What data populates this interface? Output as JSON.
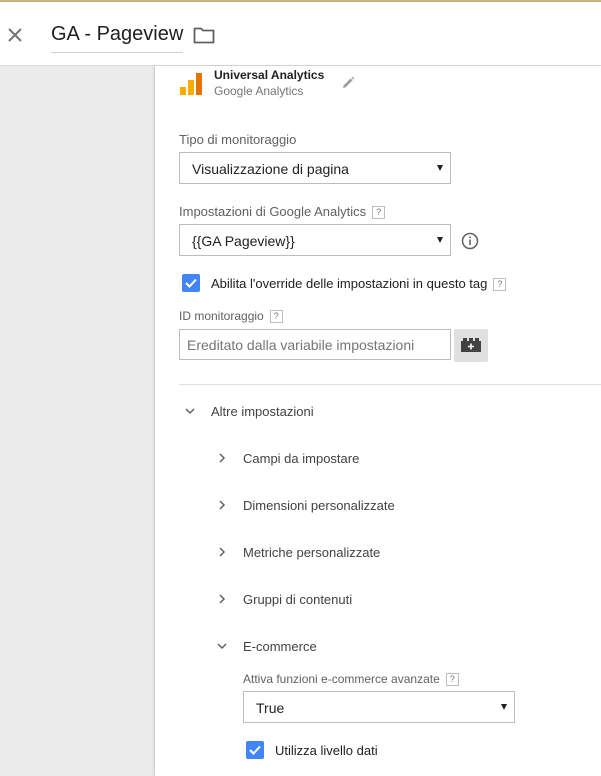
{
  "header": {
    "title": "GA - Pageview"
  },
  "tag": {
    "type_name": "Universal Analytics",
    "type_sub": "Google Analytics"
  },
  "form": {
    "tracking_type_label": "Tipo di monitoraggio",
    "tracking_type_value": "Visualizzazione di pagina",
    "ga_settings_label": "Impostazioni di Google Analytics",
    "ga_settings_value": "{{GA Pageview}}",
    "override_label": "Abilita l'override delle impostazioni in questo tag",
    "tracking_id_label": "ID monitoraggio",
    "tracking_id_placeholder": "Ereditato dalla variabile impostazioni",
    "help_glyph": "?"
  },
  "more_settings": {
    "label": "Altre impostazioni",
    "items": [
      {
        "label": "Campi da impostare"
      },
      {
        "label": "Dimensioni personalizzate"
      },
      {
        "label": "Metriche personalizzate"
      },
      {
        "label": "Gruppi di contenuti"
      },
      {
        "label": "E-commerce"
      }
    ]
  },
  "ecommerce": {
    "enhanced_label": "Attiva funzioni e-commerce avanzate",
    "enhanced_value": "True",
    "datalayer_label": "Utilizza livello dati"
  },
  "colors": {
    "checkbox": "#4285f4",
    "ga_orange": "#f9ab00",
    "ga_dark_orange": "#e37400"
  }
}
